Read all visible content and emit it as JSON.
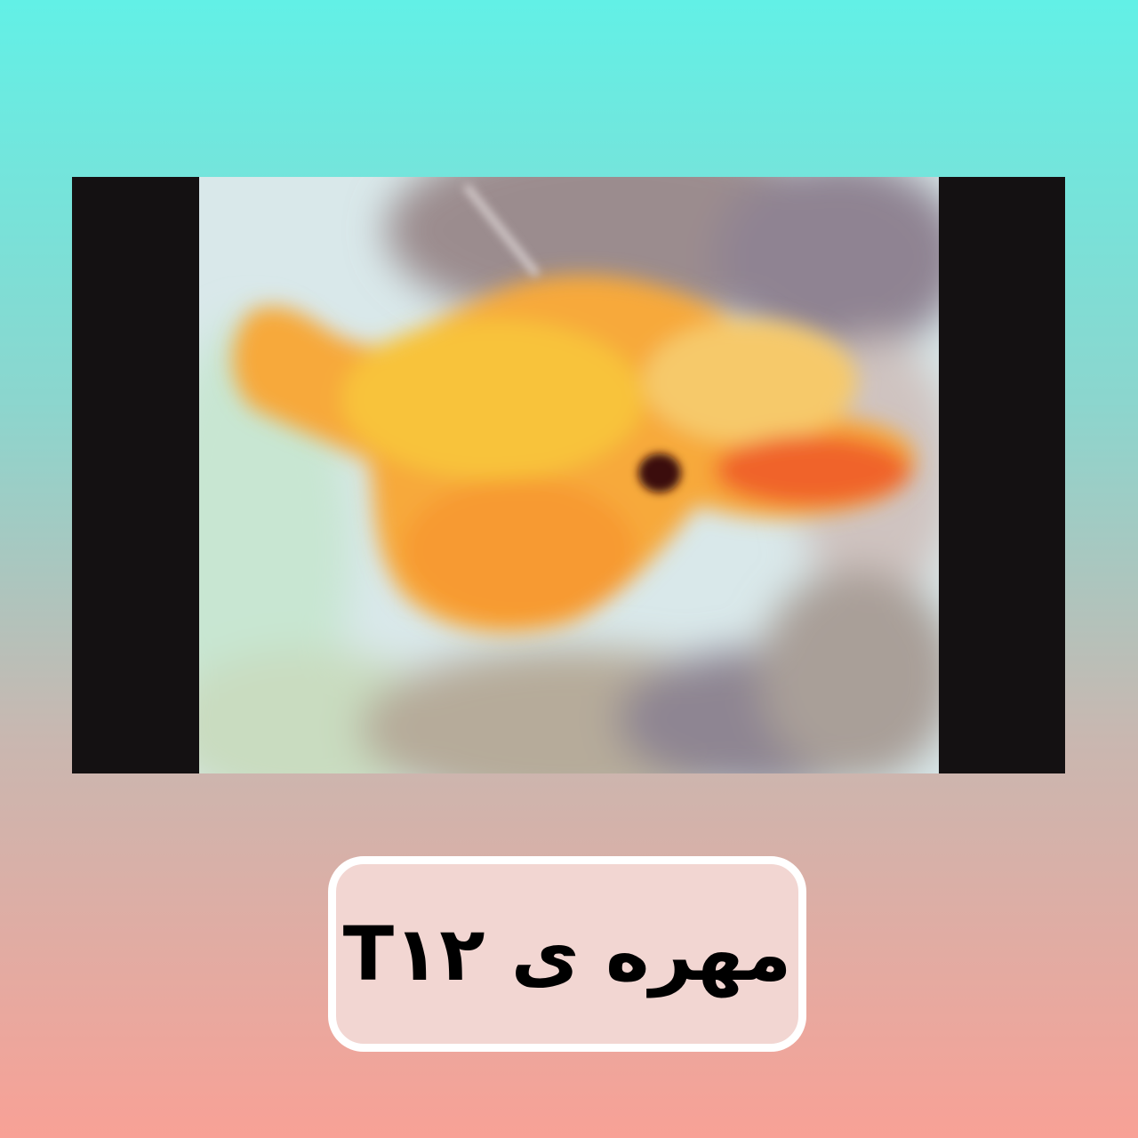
{
  "caption": {
    "text": "مهره ی T۱۲"
  },
  "video": {
    "image_subject": "blurred-vertebra-photo"
  },
  "colors": {
    "background_top": "#62F0E6",
    "background_bottom": "#F8A196",
    "frame_bars": "#141112",
    "caption_fill": "#F2D6D2",
    "caption_border": "#FFFFFF",
    "caption_text": "#000000"
  }
}
